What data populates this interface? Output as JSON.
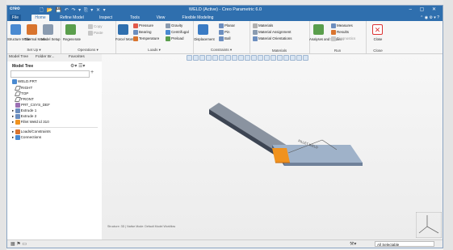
{
  "window": {
    "title": "WELD (Active) - Creo Parametric 6.0",
    "app_logo": "creo",
    "quick_access": "🗋 📂 💾 ↶ ↷ ▾ ⎘ ▾ ✕ ▾",
    "controls": "–  ▢  ✕"
  },
  "tabs": [
    {
      "label": "File",
      "active": false
    },
    {
      "label": "Home",
      "active": true
    },
    {
      "label": "Refine Model",
      "active": false
    },
    {
      "label": "Inspect",
      "active": false
    },
    {
      "label": "Tools",
      "active": false
    },
    {
      "label": "View",
      "active": false
    },
    {
      "label": "Flexible Modeling",
      "active": false
    }
  ],
  "tabs_right": "⌃ ◉ ⚙ ▾ ?",
  "ribbon": {
    "setup": {
      "label": "Set Up ▾",
      "items": [
        "Structure Mode",
        "Thermal Mode",
        "Model Setup"
      ]
    },
    "operations": {
      "label": "Operations ▾",
      "items": [
        "Regenerate",
        "Copy",
        "Paste"
      ]
    },
    "loads": {
      "label": "Loads ▾",
      "big": "Force/ Moment",
      "items": [
        "Pressure",
        "Bearing",
        "Temperature",
        "Gravity",
        "Centrifugal",
        "Preload"
      ]
    },
    "constraints": {
      "label": "Constraints ▾",
      "big": "Displacement",
      "items": [
        "Planar",
        "Pin",
        "Ball"
      ]
    },
    "materials": {
      "label": "Materials",
      "items": [
        "Materials",
        "Material Assignment",
        "Material Orientations"
      ]
    },
    "run": {
      "label": "Run",
      "big": "Analyses and Studies",
      "items": [
        "Measures",
        "Results",
        "Diagnostics"
      ]
    },
    "close": {
      "label": "Close",
      "big": "Close"
    }
  },
  "left_tabs": [
    "Model Tree",
    "Folder Br...",
    "Favorites"
  ],
  "model_tree": {
    "title": "Model Tree",
    "items": [
      {
        "label": "WELD.PRT",
        "icon": "part-icon"
      },
      {
        "label": "RIGHT",
        "icon": "datum-plane-icon"
      },
      {
        "label": "TOP",
        "icon": "datum-plane-icon"
      },
      {
        "label": "FRONT",
        "icon": "datum-plane-icon"
      },
      {
        "label": "PRT_CSYS_DEF",
        "icon": "csys-icon"
      },
      {
        "label": "Extrude 1",
        "icon": "extrude-icon"
      },
      {
        "label": "Extrude 2",
        "icon": "extrude-icon"
      },
      {
        "label": "Fillet Weld id 310",
        "icon": "weld-icon"
      },
      {
        "label": "Loads/Constraints",
        "icon": "loads-icon"
      },
      {
        "label": "Connections",
        "icon": "connections-icon"
      }
    ]
  },
  "graphics": {
    "weld_label": "FILLET WELD",
    "status_message": "Structure: 3D | Native Mode: Default Model Workflow"
  },
  "statusbar": {
    "filter": "All Selectable"
  },
  "colors": {
    "accent": "#2f6fae",
    "weld": "#f0921e",
    "plate_top": "#8fa3bd",
    "plate_dark": "#3d4553"
  }
}
